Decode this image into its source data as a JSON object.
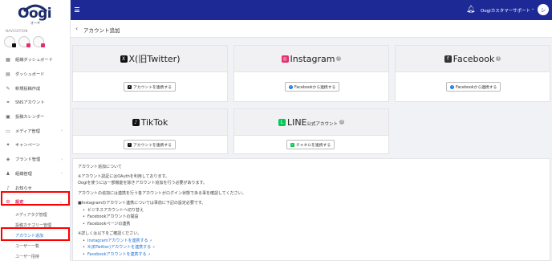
{
  "logo": {
    "text": "Oogi",
    "sub": "オーギ"
  },
  "sidebar": {
    "section_label": "NAVIGATION",
    "accounts": [
      {
        "badge_color": "#111111"
      },
      {
        "badge_color": "#e1306c"
      },
      {
        "badge_color": "#e1306c"
      }
    ],
    "items": [
      {
        "label": "組織ダッシュボード",
        "icon": "grid-icon",
        "chevron": false
      },
      {
        "label": "ダッシュボード",
        "icon": "dashboard-icon",
        "chevron": false
      },
      {
        "label": "新規投稿作成",
        "icon": "edit-icon",
        "chevron": false
      },
      {
        "label": "SNSアカウント",
        "icon": "link-icon",
        "chevron": false
      },
      {
        "label": "投稿カレンダー",
        "icon": "calendar-icon",
        "chevron": false
      },
      {
        "label": "メディア管理",
        "icon": "folder-icon",
        "chevron": true
      },
      {
        "label": "キャンペーン",
        "icon": "gift-icon",
        "chevron": false
      },
      {
        "label": "ブランド管理",
        "icon": "tag-icon",
        "chevron": true
      },
      {
        "label": "組織管理",
        "icon": "users-icon",
        "chevron": true
      },
      {
        "label": "お知らせ",
        "icon": "bell-icon",
        "chevron": false
      },
      {
        "label": "設定",
        "icon": "gear-icon",
        "chevron": true,
        "active": true
      }
    ],
    "sub_items": [
      {
        "label": "メディアタグ管理"
      },
      {
        "label": "投稿カテゴリー管理"
      },
      {
        "label": "アカウント追加",
        "current": true
      },
      {
        "label": "ユーザー一覧"
      },
      {
        "label": "ユーザー招待"
      }
    ]
  },
  "header": {
    "user_name": "Oogiカスタマーサポート",
    "avatar_initial": "シ"
  },
  "page": {
    "back_icon": "chevron-left-icon",
    "title": "アカウント追加"
  },
  "cards": [
    {
      "name": "x",
      "title": "X(旧Twitter)",
      "suffix": "",
      "help": false,
      "icon_color": "#111111",
      "icon_glyph": "X",
      "button": "アカウントを連携する",
      "button_icon_color": "#111111",
      "button_icon_glyph": "X"
    },
    {
      "name": "instagram",
      "title": "Instagram",
      "suffix": "",
      "help": true,
      "icon_color": "#e1306c",
      "icon_glyph": "◎",
      "button": "Facebookから連携する",
      "button_icon_color": "#1877f2",
      "button_icon_glyph": "f"
    },
    {
      "name": "facebook",
      "title": "Facebook",
      "suffix": "",
      "help": true,
      "icon_color": "#333333",
      "icon_glyph": "f",
      "button": "Facebookから連携する",
      "button_icon_color": "#1877f2",
      "button_icon_glyph": "f"
    },
    {
      "name": "tiktok",
      "title": "TikTok",
      "suffix": "",
      "help": false,
      "icon_color": "#111111",
      "icon_glyph": "♪",
      "button": "アカウントを連携する",
      "button_icon_color": "#111111",
      "button_icon_glyph": "♪"
    },
    {
      "name": "line",
      "title": "LINE",
      "suffix": "公式アカウント",
      "help": true,
      "icon_color": "#06c755",
      "icon_glyph": "L",
      "button": "チャネルを連携する",
      "button_icon_color": "#06c755",
      "button_icon_glyph": "L"
    }
  ],
  "info": {
    "title": "アカウント追加について",
    "notes": [
      "※アカウント認証にはOAuthを利用しております。",
      "Oogiを使うには一部機能を除きアカウント追加を行う必要があります。"
    ],
    "note2": "アカウントの追加には連携を行う各アカウントがログイン状態である事を確認してください。",
    "ig_title": "■Instagramのアカウント連携については事前に下記の設定必要です。",
    "ig_list": [
      "ビジネスアカウントへ切り替え",
      "Facebookアカウントの開設",
      "Facebookページの連携"
    ],
    "more": "※詳しくは以下をご確認ください。",
    "links": [
      "Instagramアカウントを連携する",
      "X(旧Twitter)アカウントを連携する",
      "Facebookアカウントを連携する"
    ]
  }
}
